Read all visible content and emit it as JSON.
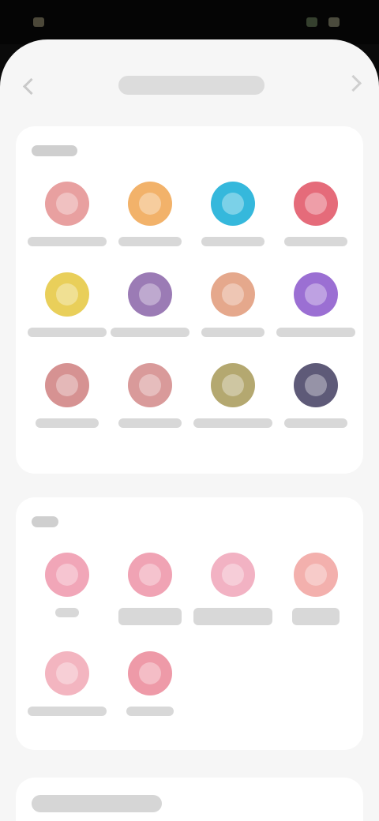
{
  "status_bar": {
    "time": "",
    "battery": ""
  },
  "header": {
    "title": "",
    "back_icon": "chevron-left-icon",
    "action_icon": "chevron-right-icon"
  },
  "section1": {
    "title": "",
    "items": [
      {
        "label": "",
        "color": "#e8a0a0"
      },
      {
        "label": "",
        "color": "#f2b26a"
      },
      {
        "label": "",
        "color": "#35b8dc"
      },
      {
        "label": "",
        "color": "#e56b7a"
      },
      {
        "label": "",
        "color": "#e9cf5a"
      },
      {
        "label": "",
        "color": "#9b7bb5"
      },
      {
        "label": "",
        "color": "#e5a88c"
      },
      {
        "label": "",
        "color": "#9b6fd3"
      },
      {
        "label": "",
        "color": "#d69292"
      },
      {
        "label": "",
        "color": "#d99a9a"
      },
      {
        "label": "",
        "color": "#b4a870"
      },
      {
        "label": "",
        "color": "#5e5a78"
      }
    ]
  },
  "section2": {
    "title": "",
    "items": [
      {
        "label": "",
        "color": "#f1a6b8"
      },
      {
        "label": "",
        "color": "#f0a3b4"
      },
      {
        "label": "",
        "color": "#f2b2c3"
      },
      {
        "label": "",
        "color": "#f3b0ad"
      },
      {
        "label": "",
        "color": "#f3b5c0"
      },
      {
        "label": "",
        "color": "#ee9aa8"
      }
    ]
  },
  "section3": {
    "title": ""
  }
}
